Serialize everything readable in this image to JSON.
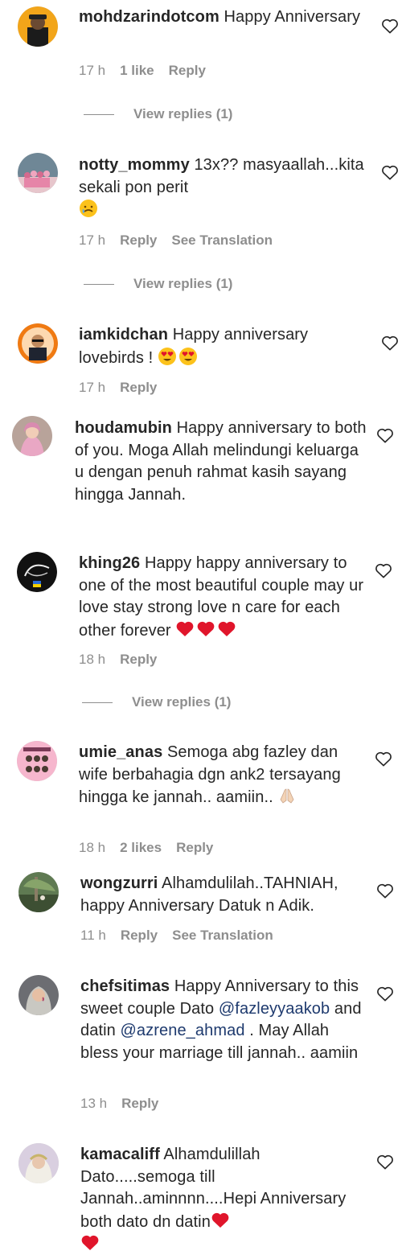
{
  "colors": {
    "text": "#262626",
    "muted": "#8e8e8e",
    "mention": "#1e3a6e",
    "heart_red": "#e0152b"
  },
  "comments": [
    {
      "username": "mohdzarindotcom",
      "text": " Happy Anniversary",
      "time": "17 h",
      "likes": "1 like",
      "reply": "Reply",
      "view_replies": "View replies (1)"
    },
    {
      "username": "notty_mommy",
      "text": " 13x?? masyaallah...kita sekali pon perit",
      "emoji": "crying-face",
      "time": "17 h",
      "reply": "Reply",
      "translate": "See Translation",
      "view_replies": "View replies (1)"
    },
    {
      "username": "iamkidchan",
      "text": " Happy anniversary lovebirds !",
      "emoji": "heart-eyes-face",
      "time": "17 h",
      "reply": "Reply"
    },
    {
      "username": "houdamubin",
      "text": " Happy anniversary to both of you. Moga Allah melindungi keluarga u dengan penuh rahmat kasih sayang hingga Jannah."
    },
    {
      "username": "khing26",
      "text": " Happy happy anniversary to one of the most beautiful couple may ur love stay strong love n care for each other forever",
      "emoji": "red-heart",
      "time": "18 h",
      "reply": "Reply",
      "view_replies": "View replies (1)"
    },
    {
      "username": "umie_anas",
      "text": " Semoga abg fazley dan wife berbahagia dgn ank2 tersayang hingga ke jannah.. aamiin..",
      "emoji": "praying-hands",
      "time": "18 h",
      "likes": "2 likes",
      "reply": "Reply"
    },
    {
      "username": "wongzurri",
      "text": " Alhamdulilah..TAHNIAH, happy Anniversary Datuk n Adik.",
      "time": "11 h",
      "reply": "Reply",
      "translate": "See Translation"
    },
    {
      "username": "chefsitimas",
      "text1": " Happy Anniversary to this sweet couple Dato ",
      "mention1": "@fazleyyaakob",
      "text2": " and datin ",
      "mention2": "@azrene_ahmad",
      "text3": " . May Allah bless your marriage till jannah.. aamiin",
      "time": "13 h",
      "reply": "Reply"
    },
    {
      "username": "kamacaliff",
      "text": " Alhamdulillah Dato.....semoga till Jannah..aminnnn....Hepi Anniversary both dato dn datin",
      "emoji": "red-heart"
    }
  ]
}
